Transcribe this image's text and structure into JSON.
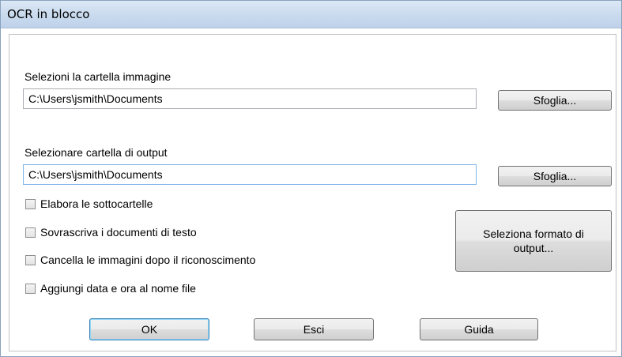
{
  "window": {
    "title": "OCR in blocco"
  },
  "image_folder": {
    "label": "Selezioni la cartella immagine",
    "value": "C:\\Users\\jsmith\\Documents",
    "browse_label": "Sfoglia..."
  },
  "output_folder": {
    "label": "Selezionare cartella di output",
    "value": "C:\\Users\\jsmith\\Documents",
    "browse_label": "Sfoglia..."
  },
  "options": [
    {
      "label": "Elabora le sottocartelle",
      "checked": false
    },
    {
      "label": "Sovrascriva i documenti di testo",
      "checked": false
    },
    {
      "label": "Cancella le immagini dopo il riconoscimento",
      "checked": false
    },
    {
      "label": "Aggiungi data e ora al nome file",
      "checked": false
    }
  ],
  "format_button": {
    "line1": "Seleziona formato di",
    "line2": "output..."
  },
  "footer": {
    "ok": "OK",
    "exit": "Esci",
    "help": "Guida"
  }
}
